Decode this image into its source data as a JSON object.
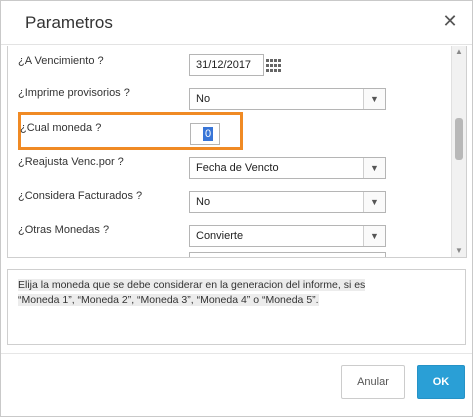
{
  "dialog": {
    "title": "Parametros",
    "close_icon": "close-icon"
  },
  "form": {
    "rows": [
      {
        "label": "¿A Vencimiento ?",
        "value": "31/12/2017",
        "control": "date-input"
      },
      {
        "label": "¿Imprime provisorios ?",
        "value": "No",
        "control": "select"
      },
      {
        "label": "¿Cual moneda ?",
        "value": "0",
        "control": "text-input"
      },
      {
        "label": "¿Reajusta Venc.por ?",
        "value": "Fecha de Vencto",
        "control": "select"
      },
      {
        "label": "¿Considera Facturados ?",
        "value": "No",
        "control": "select"
      },
      {
        "label": "¿Otras Monedas ?",
        "value": "Convierte",
        "control": "select"
      }
    ],
    "highlight_color": "#f08a24"
  },
  "help": {
    "line1": "Elija la moneda que se debe considerar en la generacion del informe, si es",
    "line2": "“Moneda 1”, “Moneda 2”, “Moneda 3”, “Moneda 4” o “Moneda 5”."
  },
  "buttons": {
    "cancel_label": "Anular",
    "ok_label": "OK",
    "ok_color": "#2a9fd6"
  }
}
